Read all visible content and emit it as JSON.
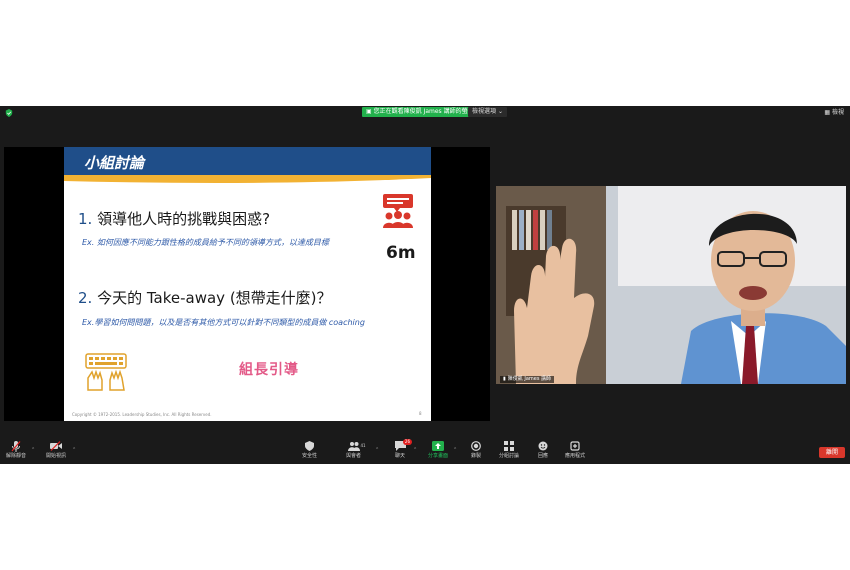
{
  "top_bar": {
    "share_banner": "您正在觀看陳俊凱 James 講師的螢幕",
    "view_options": "檢視選項",
    "view_label": "檢視"
  },
  "slide": {
    "title": "小組討論",
    "q1_number": "1.",
    "q1_text": "領導他人時的挑戰與困惑?",
    "q1_example": "Ex. 如何因應不同能力跟性格的成員給予不同的領導方式，以達成目標",
    "time": "6m",
    "q2_number": "2.",
    "q2_text": "今天的 Take-away (想帶走什麼)？",
    "q2_example": "Ex.學習如何問問題，以及是否有其他方式可以針對不同類型的成員做 coaching",
    "leader_text": "組長引導",
    "copyright": "Copyright © 1972-2015. Leadership Studies, Inc. All Rights Reserved.",
    "page_number": "8"
  },
  "video": {
    "participant_name": "陳俊凱 James 講師"
  },
  "toolbar": {
    "unmute": "解除靜音",
    "start_video": "開始視訊",
    "security": "安全性",
    "participants": "與會者",
    "participants_count": "41",
    "chat": "聊天",
    "chat_badge": "26",
    "share_screen": "分享畫面",
    "record": "錄製",
    "breakout": "分組討論",
    "reactions": "回應",
    "apps": "應用程式",
    "end": "離開"
  },
  "colors": {
    "slide_header": "#1f4e89",
    "share_green": "#22b14c",
    "end_red": "#d9372b",
    "leader_pink": "#e35a88"
  }
}
